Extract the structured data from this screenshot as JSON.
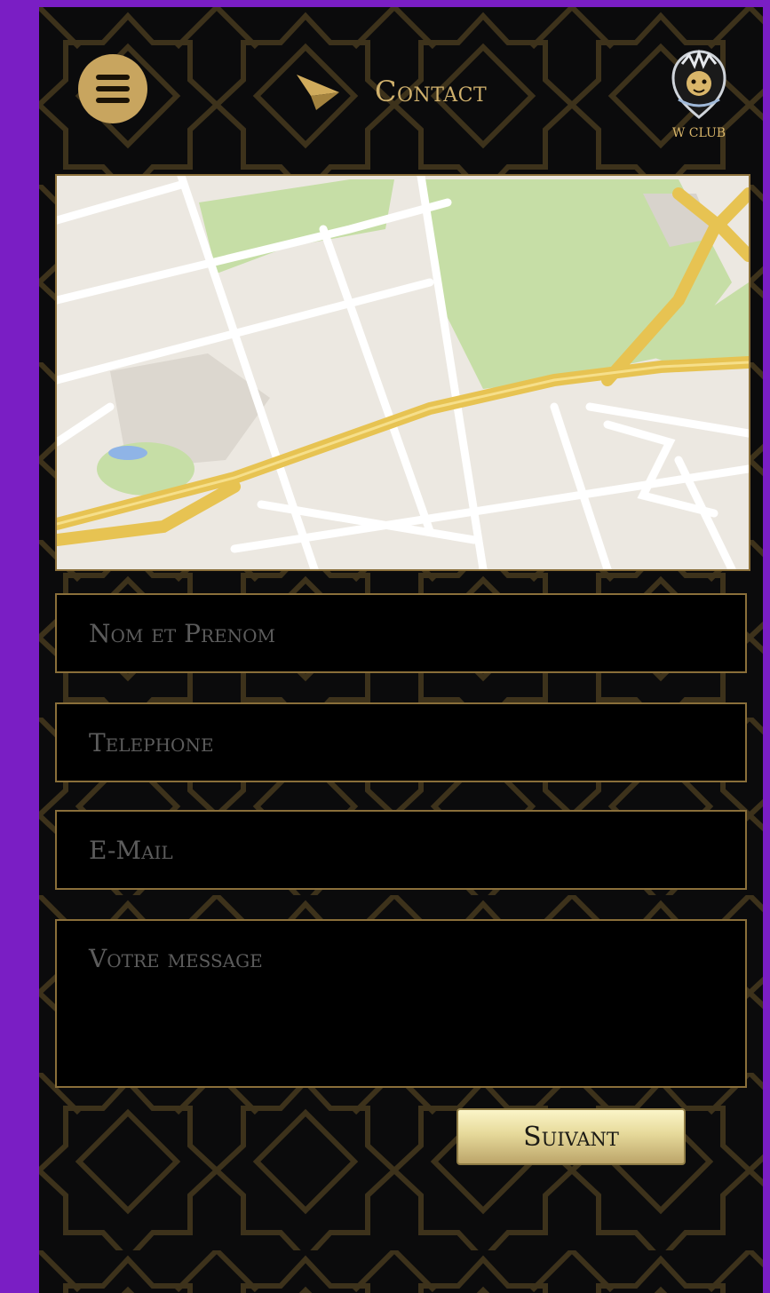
{
  "header": {
    "menu_icon": "hamburger-menu-icon",
    "title_icon": "paper-plane-icon",
    "title": "Contact",
    "logo_icon": "lion-crest-logo",
    "logo_text": "W CLUB"
  },
  "map": {
    "icon": "street-map"
  },
  "form": {
    "name_placeholder": "Nom et Prenom",
    "phone_placeholder": "Telephone",
    "email_placeholder": "E-Mail",
    "message_placeholder": "Votre message",
    "submit_label": "Suivant"
  },
  "colors": {
    "accent_gold": "#c8a55f",
    "background": "#0b0b0c",
    "frame": "#7a1ec4"
  }
}
